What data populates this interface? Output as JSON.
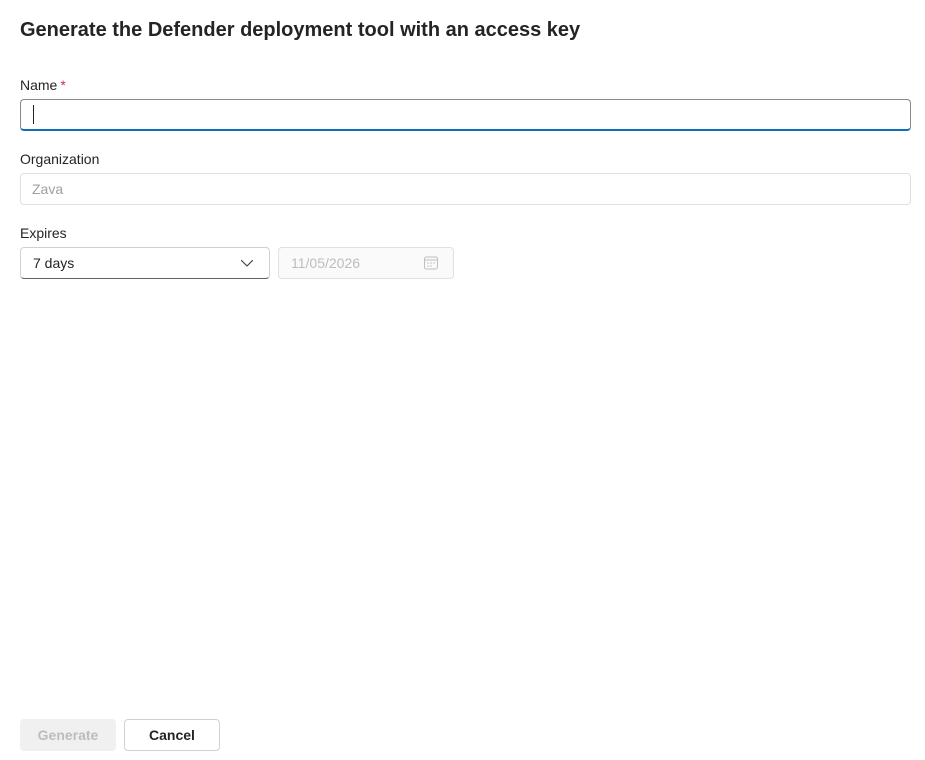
{
  "header": {
    "title": "Generate the Defender deployment tool with an access key"
  },
  "form": {
    "name": {
      "label": "Name",
      "required_marker": "*",
      "value": "",
      "placeholder": ""
    },
    "organization": {
      "label": "Organization",
      "value": "",
      "placeholder": "Zava"
    },
    "expires": {
      "label": "Expires",
      "selected_option": "7 days",
      "date_value": "11/05/2026"
    }
  },
  "footer": {
    "generate_label": "Generate",
    "cancel_label": "Cancel"
  },
  "icons": {
    "dropdown": "chevron-down-icon",
    "date": "calendar-icon"
  },
  "colors": {
    "accent": "#0f6cbd",
    "required": "#c4314b",
    "text": "#242424",
    "disabled_text": "#bdbdbd"
  }
}
